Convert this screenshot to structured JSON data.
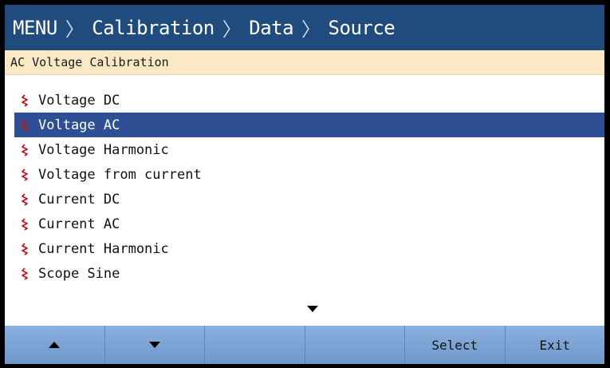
{
  "header": {
    "breadcrumb": [
      "MENU",
      "Calibration",
      "Data",
      "Source"
    ],
    "separator": "〉"
  },
  "subheader": {
    "title": "AC Voltage Calibration"
  },
  "list": {
    "items": [
      {
        "label": "Voltage DC",
        "selected": false
      },
      {
        "label": "Voltage AC",
        "selected": true
      },
      {
        "label": "Voltage Harmonic",
        "selected": false
      },
      {
        "label": "Voltage from current",
        "selected": false
      },
      {
        "label": "Current DC",
        "selected": false
      },
      {
        "label": "Current AC",
        "selected": false
      },
      {
        "label": "Current Harmonic",
        "selected": false
      },
      {
        "label": "Scope Sine",
        "selected": false
      }
    ],
    "item_icon": "waveform-icon",
    "more_indicator_icon": "scroll-down-arrow-icon"
  },
  "softkeys": [
    {
      "label": "",
      "icon": "up-arrow-icon"
    },
    {
      "label": "",
      "icon": "down-arrow-icon"
    },
    {
      "label": "",
      "icon": ""
    },
    {
      "label": "",
      "icon": ""
    },
    {
      "label": "Select",
      "icon": ""
    },
    {
      "label": "Exit",
      "icon": ""
    }
  ],
  "colors": {
    "header_bg": "#1f4b7d",
    "subheader_bg": "#fbe9c6",
    "selection_bg": "#2e4f94",
    "icon_red": "#c0141c",
    "softkey_bg": "#7ea5d6"
  }
}
